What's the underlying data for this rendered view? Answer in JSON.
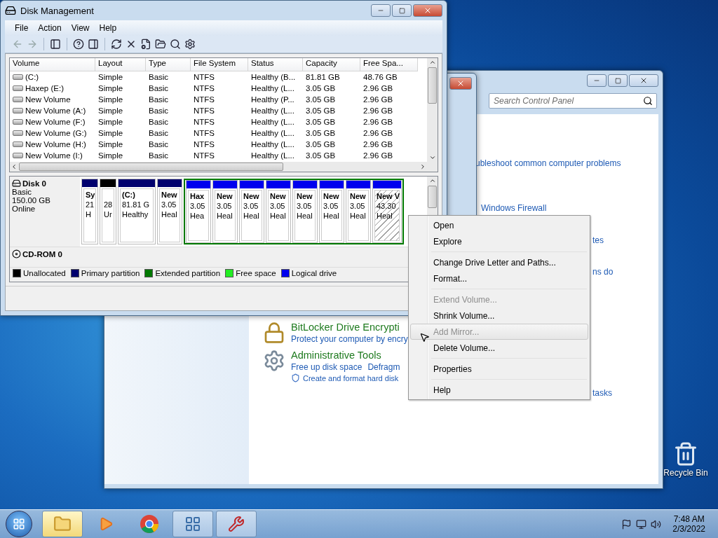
{
  "disk_management": {
    "title": "Disk Management",
    "menu": [
      "File",
      "Action",
      "View",
      "Help"
    ],
    "columns": [
      "Volume",
      "Layout",
      "Type",
      "File System",
      "Status",
      "Capacity",
      "Free Spa..."
    ],
    "rows": [
      {
        "cells": [
          "(C:)",
          "Simple",
          "Basic",
          "NTFS",
          "Healthy (B...",
          "81.81 GB",
          "48.76 GB"
        ]
      },
      {
        "cells": [
          "Haxep (E:)",
          "Simple",
          "Basic",
          "NTFS",
          "Healthy (L...",
          "3.05 GB",
          "2.96 GB"
        ]
      },
      {
        "cells": [
          "New Volume",
          "Simple",
          "Basic",
          "NTFS",
          "Healthy (P...",
          "3.05 GB",
          "2.96 GB"
        ]
      },
      {
        "cells": [
          "New Volume (A:)",
          "Simple",
          "Basic",
          "NTFS",
          "Healthy (L...",
          "3.05 GB",
          "2.96 GB"
        ]
      },
      {
        "cells": [
          "New Volume (F:)",
          "Simple",
          "Basic",
          "NTFS",
          "Healthy (L...",
          "3.05 GB",
          "2.96 GB"
        ]
      },
      {
        "cells": [
          "New Volume (G:)",
          "Simple",
          "Basic",
          "NTFS",
          "Healthy (L...",
          "3.05 GB",
          "2.96 GB"
        ]
      },
      {
        "cells": [
          "New Volume (H:)",
          "Simple",
          "Basic",
          "NTFS",
          "Healthy (L...",
          "3.05 GB",
          "2.96 GB"
        ]
      },
      {
        "cells": [
          "New Volume (I:)",
          "Simple",
          "Basic",
          "NTFS",
          "Healthy (L...",
          "3.05 GB",
          "2.96 GB"
        ]
      }
    ],
    "disks": [
      {
        "kind": "disk",
        "name": "Disk 0",
        "lines": [
          "Basic",
          "150.00 GB",
          "Online"
        ],
        "partitions": [
          {
            "kind": "primary",
            "selected": false,
            "name": "Sy",
            "lines": [
              "21",
              "H"
            ]
          },
          {
            "kind": "unallocated",
            "selected": false,
            "lines": [
              "28",
              "Ur"
            ]
          },
          {
            "kind": "primary",
            "selected": false,
            "name": "(C:)",
            "lines": [
              "81.81 G",
              "Healthy"
            ]
          },
          {
            "kind": "primary",
            "selected": false,
            "name": "New",
            "lines": [
              "3.05",
              "Heal"
            ]
          },
          {
            "kind": "extended",
            "children": [
              {
                "kind": "logical",
                "selected": false,
                "name": "Hax",
                "lines": [
                  "3.05",
                  "Hea"
                ]
              },
              {
                "kind": "logical",
                "selected": false,
                "name": "New",
                "lines": [
                  "3.05",
                  "Heal"
                ]
              },
              {
                "kind": "logical",
                "selected": false,
                "name": "New",
                "lines": [
                  "3.05",
                  "Heal"
                ]
              },
              {
                "kind": "logical",
                "selected": false,
                "name": "New",
                "lines": [
                  "3.05",
                  "Heal"
                ]
              },
              {
                "kind": "logical",
                "selected": false,
                "name": "New",
                "lines": [
                  "3.05",
                  "Heal"
                ]
              },
              {
                "kind": "logical",
                "selected": false,
                "name": "New",
                "lines": [
                  "3.05",
                  "Heal"
                ]
              },
              {
                "kind": "logical",
                "selected": false,
                "name": "New",
                "lines": [
                  "3.05",
                  "Heal"
                ]
              },
              {
                "kind": "logical",
                "selected": true,
                "name": "New V",
                "lines": [
                  "43.30",
                  "Heal"
                ]
              }
            ]
          }
        ]
      },
      {
        "kind": "cdrom",
        "name": "CD-ROM 0"
      }
    ],
    "legend": [
      {
        "label": "Unallocated",
        "color": "#000000"
      },
      {
        "label": "Primary partition",
        "color": "#00006e"
      },
      {
        "label": "Extended partition",
        "color": "#007800"
      },
      {
        "label": "Free space",
        "color": "#22ee22"
      },
      {
        "label": "Logical drive",
        "color": "#0000ee"
      }
    ]
  },
  "context_menu": {
    "groups": [
      [
        {
          "label": "Open",
          "disabled": false,
          "selected": false
        },
        {
          "label": "Explore",
          "disabled": false,
          "selected": false
        }
      ],
      [
        {
          "label": "Change Drive Letter and Paths...",
          "disabled": false,
          "selected": false
        },
        {
          "label": "Format...",
          "disabled": false,
          "selected": false
        }
      ],
      [
        {
          "label": "Extend Volume...",
          "disabled": true,
          "selected": false
        },
        {
          "label": "Shrink Volume...",
          "disabled": false,
          "selected": false
        },
        {
          "label": "Add Mirror...",
          "disabled": true,
          "selected": true
        },
        {
          "label": "Delete Volume...",
          "disabled": false,
          "selected": false
        }
      ],
      [
        {
          "label": "Properties",
          "disabled": false,
          "selected": false
        }
      ],
      [
        {
          "label": "Help",
          "disabled": false,
          "selected": false
        }
      ]
    ]
  },
  "control_panel": {
    "search": {
      "placeholder": "Search Control Panel"
    },
    "fragments": [
      "ubleshoot common computer problems",
      "Windows Firewall",
      "tes",
      "ns do",
      "tasks"
    ],
    "categories": [
      {
        "kind": "bitlocker",
        "title": "BitLocker Drive Encrypti",
        "links": [
          [
            "Protect your computer by encry"
          ]
        ]
      },
      {
        "kind": "admin",
        "title": "Administrative Tools",
        "links": [
          [
            "Free up disk space",
            "Defragm"
          ],
          [
            "Create and format hard disk"
          ]
        ]
      }
    ]
  },
  "desktop_icons": [
    {
      "label": "Recycle Bin"
    }
  ],
  "taskbar": {
    "items": [
      {
        "kind": "explorer",
        "running": true,
        "highlighted": true
      },
      {
        "kind": "media",
        "running": false,
        "highlighted": false
      },
      {
        "kind": "browser",
        "running": false,
        "highlighted": false
      },
      {
        "kind": "control-panel",
        "running": true,
        "highlighted": false
      },
      {
        "kind": "disk-management",
        "running": true,
        "highlighted": false
      }
    ],
    "time": "7:48 AM",
    "date": "2/3/2022"
  }
}
